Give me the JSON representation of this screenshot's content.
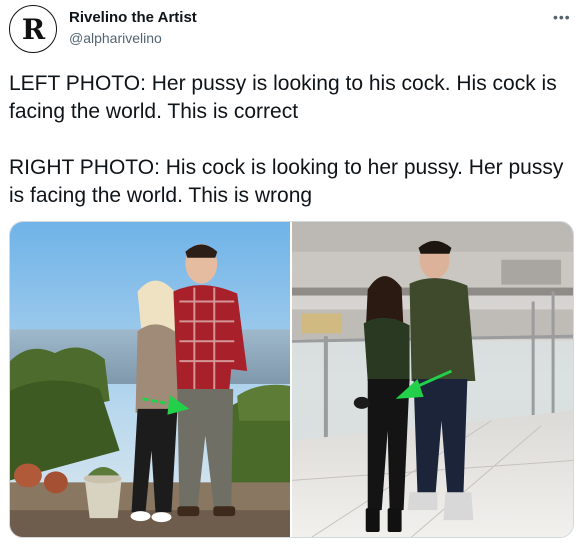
{
  "author": {
    "name": "Rivelino the Artist",
    "handle": "@alpharivelino",
    "avatar_letter": "R"
  },
  "more_icon": "•••",
  "tweet": {
    "paragraph1": "LEFT PHOTO: Her pussy is looking to his cock. His cock is facing the world. This is correct",
    "paragraph2": "RIGHT PHOTO: His cock is looking to her pussy. Her pussy is facing the world. This is wrong"
  },
  "colors": {
    "text": "#0f1419",
    "secondary": "#536471",
    "arrow": "#22d04a"
  }
}
